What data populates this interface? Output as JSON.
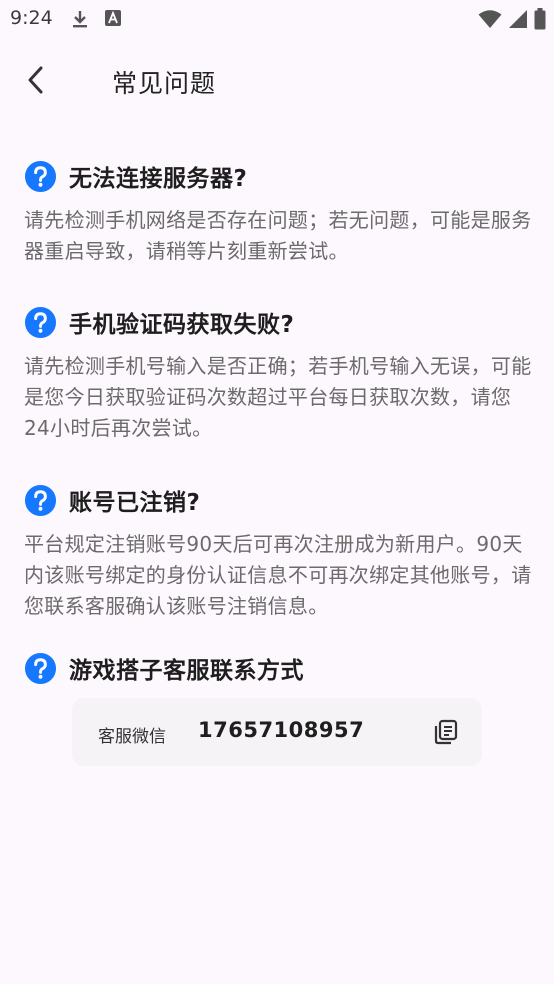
{
  "status_bar": {
    "time": "9:24",
    "left_icons": [
      "download-icon",
      "font-app-icon"
    ],
    "right_icons": [
      "wifi-icon",
      "signal-icon",
      "battery-icon"
    ]
  },
  "app_bar": {
    "back_icon": "chevron-left-icon",
    "title": "常见问题"
  },
  "faqs": [
    {
      "question": "无法连接服务器?",
      "answer": "请先检测手机网络是否存在问题；若无问题，可能是服务器重启导致，请稍等片刻重新尝试。"
    },
    {
      "question": "手机验证码获取失败?",
      "answer": "请先检测手机号输入是否正确；若手机号输入无误，可能是您今日获取验证码次数超过平台每日获取次数，请您24小时后再次尝试。"
    },
    {
      "question": "账号已注销?",
      "answer": "平台规定注销账号90天后可再次注册成为新用户。90天内该账号绑定的身份认证信息不可再次绑定其他账号，请您联系客服确认该账号注销信息。"
    },
    {
      "question": "游戏搭子客服联系方式",
      "answer": ""
    }
  ],
  "contact": {
    "label": "客服微信",
    "value": "17657108957",
    "copy_icon": "copy-icon"
  },
  "colors": {
    "accent_blue": "#1677ff",
    "background": "#fdf8fd",
    "card": "#f5f3f6"
  }
}
